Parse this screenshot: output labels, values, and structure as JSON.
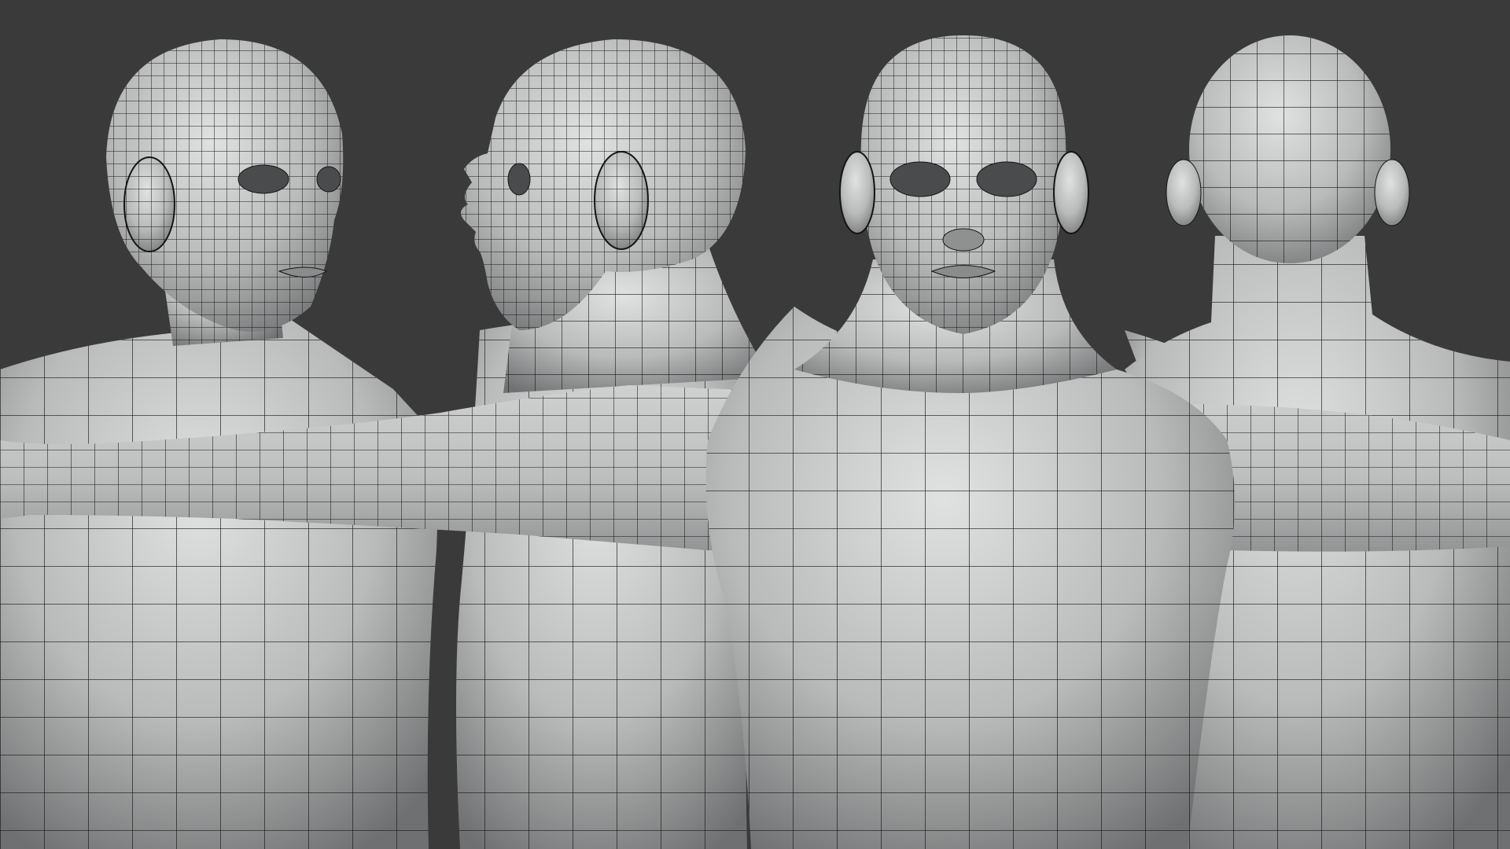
{
  "scene": {
    "background_color": "#3a3a3b",
    "mesh_color": "#b8b9b9",
    "mesh_highlight": "#dcdddd",
    "mesh_shadow": "#7c7d7e",
    "wire_color": "#141414",
    "views": [
      {
        "id": "three-quarter",
        "label": ""
      },
      {
        "id": "profile",
        "label": ""
      },
      {
        "id": "front",
        "label": ""
      },
      {
        "id": "back",
        "label": ""
      }
    ]
  }
}
